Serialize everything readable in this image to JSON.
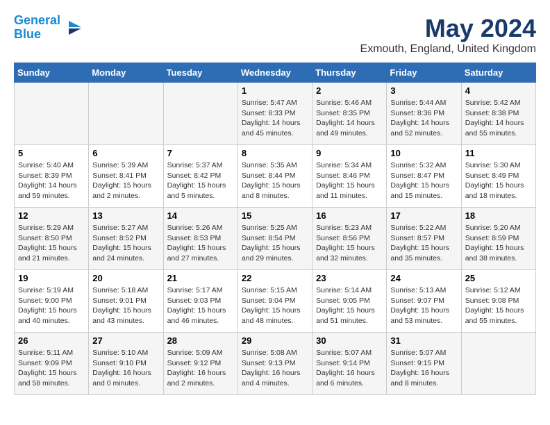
{
  "logo": {
    "line1": "General",
    "line2": "Blue"
  },
  "title": "May 2024",
  "subtitle": "Exmouth, England, United Kingdom",
  "days_of_week": [
    "Sunday",
    "Monday",
    "Tuesday",
    "Wednesday",
    "Thursday",
    "Friday",
    "Saturday"
  ],
  "weeks": [
    [
      {
        "day": "",
        "info": ""
      },
      {
        "day": "",
        "info": ""
      },
      {
        "day": "",
        "info": ""
      },
      {
        "day": "1",
        "info": "Sunrise: 5:47 AM\nSunset: 8:33 PM\nDaylight: 14 hours\nand 45 minutes."
      },
      {
        "day": "2",
        "info": "Sunrise: 5:46 AM\nSunset: 8:35 PM\nDaylight: 14 hours\nand 49 minutes."
      },
      {
        "day": "3",
        "info": "Sunrise: 5:44 AM\nSunset: 8:36 PM\nDaylight: 14 hours\nand 52 minutes."
      },
      {
        "day": "4",
        "info": "Sunrise: 5:42 AM\nSunset: 8:38 PM\nDaylight: 14 hours\nand 55 minutes."
      }
    ],
    [
      {
        "day": "5",
        "info": "Sunrise: 5:40 AM\nSunset: 8:39 PM\nDaylight: 14 hours\nand 59 minutes."
      },
      {
        "day": "6",
        "info": "Sunrise: 5:39 AM\nSunset: 8:41 PM\nDaylight: 15 hours\nand 2 minutes."
      },
      {
        "day": "7",
        "info": "Sunrise: 5:37 AM\nSunset: 8:42 PM\nDaylight: 15 hours\nand 5 minutes."
      },
      {
        "day": "8",
        "info": "Sunrise: 5:35 AM\nSunset: 8:44 PM\nDaylight: 15 hours\nand 8 minutes."
      },
      {
        "day": "9",
        "info": "Sunrise: 5:34 AM\nSunset: 8:46 PM\nDaylight: 15 hours\nand 11 minutes."
      },
      {
        "day": "10",
        "info": "Sunrise: 5:32 AM\nSunset: 8:47 PM\nDaylight: 15 hours\nand 15 minutes."
      },
      {
        "day": "11",
        "info": "Sunrise: 5:30 AM\nSunset: 8:49 PM\nDaylight: 15 hours\nand 18 minutes."
      }
    ],
    [
      {
        "day": "12",
        "info": "Sunrise: 5:29 AM\nSunset: 8:50 PM\nDaylight: 15 hours\nand 21 minutes."
      },
      {
        "day": "13",
        "info": "Sunrise: 5:27 AM\nSunset: 8:52 PM\nDaylight: 15 hours\nand 24 minutes."
      },
      {
        "day": "14",
        "info": "Sunrise: 5:26 AM\nSunset: 8:53 PM\nDaylight: 15 hours\nand 27 minutes."
      },
      {
        "day": "15",
        "info": "Sunrise: 5:25 AM\nSunset: 8:54 PM\nDaylight: 15 hours\nand 29 minutes."
      },
      {
        "day": "16",
        "info": "Sunrise: 5:23 AM\nSunset: 8:56 PM\nDaylight: 15 hours\nand 32 minutes."
      },
      {
        "day": "17",
        "info": "Sunrise: 5:22 AM\nSunset: 8:57 PM\nDaylight: 15 hours\nand 35 minutes."
      },
      {
        "day": "18",
        "info": "Sunrise: 5:20 AM\nSunset: 8:59 PM\nDaylight: 15 hours\nand 38 minutes."
      }
    ],
    [
      {
        "day": "19",
        "info": "Sunrise: 5:19 AM\nSunset: 9:00 PM\nDaylight: 15 hours\nand 40 minutes."
      },
      {
        "day": "20",
        "info": "Sunrise: 5:18 AM\nSunset: 9:01 PM\nDaylight: 15 hours\nand 43 minutes."
      },
      {
        "day": "21",
        "info": "Sunrise: 5:17 AM\nSunset: 9:03 PM\nDaylight: 15 hours\nand 46 minutes."
      },
      {
        "day": "22",
        "info": "Sunrise: 5:15 AM\nSunset: 9:04 PM\nDaylight: 15 hours\nand 48 minutes."
      },
      {
        "day": "23",
        "info": "Sunrise: 5:14 AM\nSunset: 9:05 PM\nDaylight: 15 hours\nand 51 minutes."
      },
      {
        "day": "24",
        "info": "Sunrise: 5:13 AM\nSunset: 9:07 PM\nDaylight: 15 hours\nand 53 minutes."
      },
      {
        "day": "25",
        "info": "Sunrise: 5:12 AM\nSunset: 9:08 PM\nDaylight: 15 hours\nand 55 minutes."
      }
    ],
    [
      {
        "day": "26",
        "info": "Sunrise: 5:11 AM\nSunset: 9:09 PM\nDaylight: 15 hours\nand 58 minutes."
      },
      {
        "day": "27",
        "info": "Sunrise: 5:10 AM\nSunset: 9:10 PM\nDaylight: 16 hours\nand 0 minutes."
      },
      {
        "day": "28",
        "info": "Sunrise: 5:09 AM\nSunset: 9:12 PM\nDaylight: 16 hours\nand 2 minutes."
      },
      {
        "day": "29",
        "info": "Sunrise: 5:08 AM\nSunset: 9:13 PM\nDaylight: 16 hours\nand 4 minutes."
      },
      {
        "day": "30",
        "info": "Sunrise: 5:07 AM\nSunset: 9:14 PM\nDaylight: 16 hours\nand 6 minutes."
      },
      {
        "day": "31",
        "info": "Sunrise: 5:07 AM\nSunset: 9:15 PM\nDaylight: 16 hours\nand 8 minutes."
      },
      {
        "day": "",
        "info": ""
      }
    ]
  ]
}
